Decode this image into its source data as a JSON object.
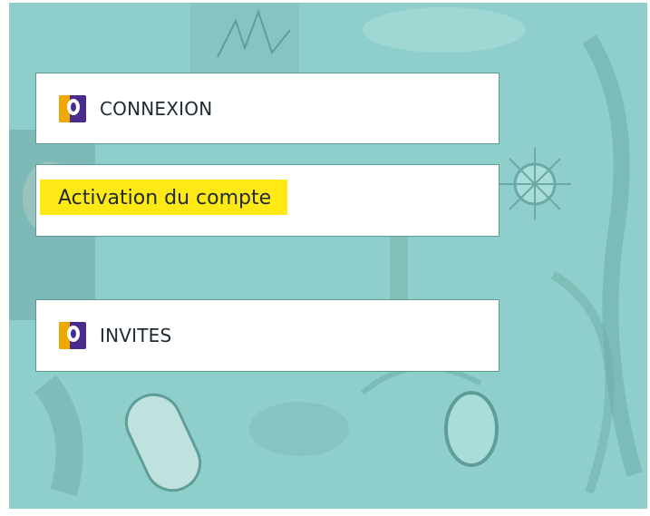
{
  "menu": {
    "login_label": "CONNEXION",
    "activation_label": "Activation du compte",
    "guests_label": "INVITES"
  },
  "icons": {
    "brand": "brand-logo-icon"
  },
  "colors": {
    "background": "#8fcfcb",
    "card": "#ffffff",
    "highlight": "#ffe914",
    "logo_orange": "#f0a800",
    "logo_purple": "#4a2a8c"
  }
}
